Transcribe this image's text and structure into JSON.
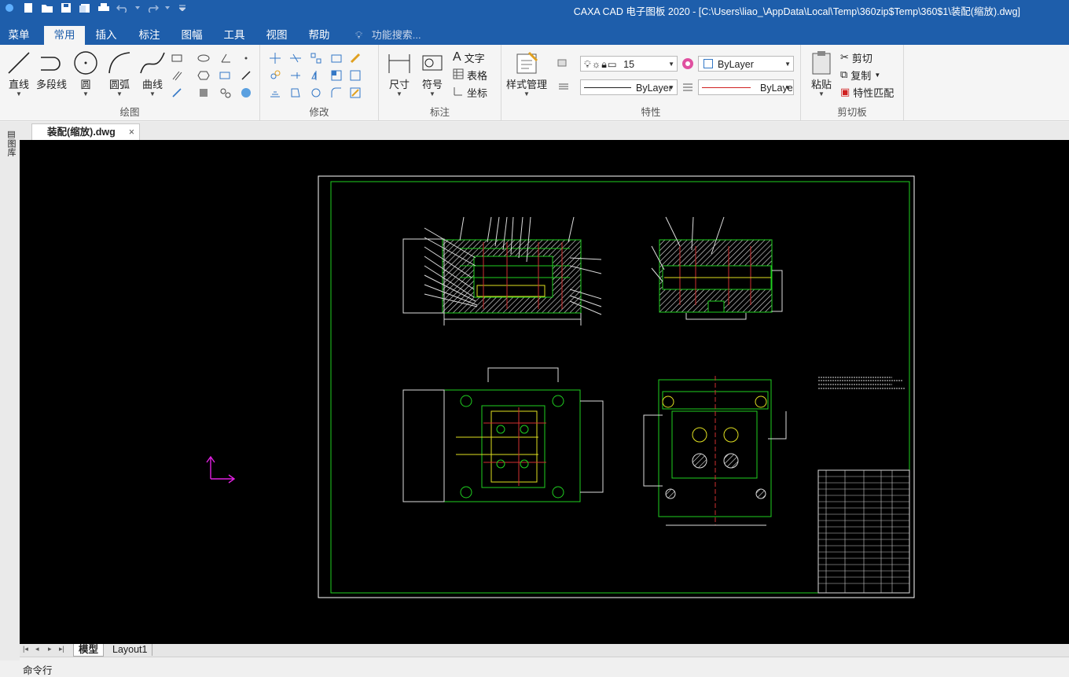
{
  "window": {
    "title": "CAXA CAD 电子图板 2020 - [C:\\Users\\liao_\\AppData\\Local\\Temp\\360zip$Temp\\360$1\\装配(缩放).dwg]"
  },
  "tabs": [
    "菜单",
    "常用",
    "插入",
    "标注",
    "图幅",
    "工具",
    "视图",
    "帮助"
  ],
  "active_tab": "常用",
  "search": {
    "placeholder": "功能搜索..."
  },
  "groups": {
    "draw": {
      "label": "绘图",
      "line": "直线",
      "polyline": "多段线",
      "circle": "圆",
      "arc": "圆弧",
      "curve": "曲线"
    },
    "modify": {
      "label": "修改"
    },
    "annotate": {
      "label": "标注",
      "dimension": "尺寸",
      "symbol": "符号",
      "text": "文字",
      "table": "表格",
      "coordinate": "坐标"
    },
    "properties": {
      "label": "特性",
      "style_manager": "样式管理",
      "layer_num": "15",
      "color": "ByLayer",
      "linetype": "ByLayer",
      "lineweight": "ByLaye"
    },
    "clipboard": {
      "label": "剪切板",
      "paste": "粘贴",
      "cut": "剪切",
      "copy": "复制",
      "match": "特性匹配"
    }
  },
  "document": {
    "tab": "装配(缩放).dwg",
    "close": "×"
  },
  "side_panel": {
    "label": "图库"
  },
  "layouts": [
    "模型",
    "Layout1"
  ],
  "cmdline": {
    "label": "命令行"
  }
}
